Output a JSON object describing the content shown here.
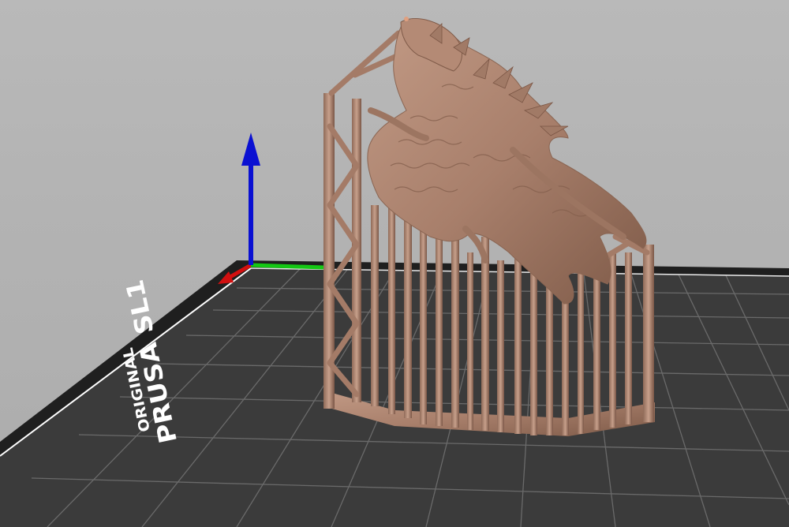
{
  "viewport": {
    "background_color": "#b5b5b5",
    "bed_color": "#3a3a3a",
    "bed_border_color": "#1f1f1f",
    "grid_line_color": "#6a6a6a",
    "model_color": "#a87f6b"
  },
  "bed": {
    "logo_line1": "ORIGINAL",
    "logo_line2": "PRUSA SL1"
  },
  "axes": {
    "x_color": "#d21010",
    "y_color": "#14c814",
    "z_color": "#0a10d2"
  },
  "model": {
    "icon": "dragon-model-with-supports"
  }
}
